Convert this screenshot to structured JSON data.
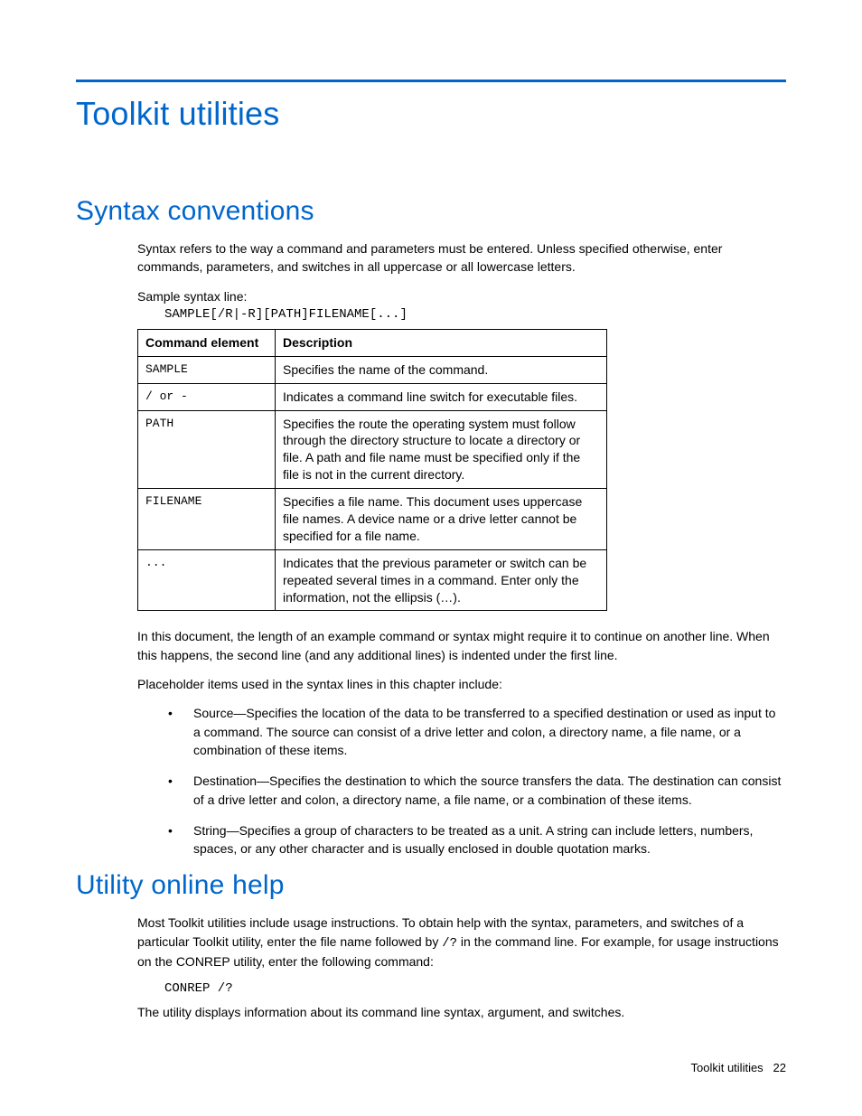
{
  "page": {
    "title": "Toolkit utilities",
    "footer_label": "Toolkit utilities",
    "footer_page": "22"
  },
  "section1": {
    "heading": "Syntax conventions",
    "intro": "Syntax refers to the way a command and parameters must be entered. Unless specified otherwise, enter commands, parameters, and switches in all uppercase or all lowercase letters.",
    "sample_label": "Sample syntax line:",
    "sample_code": "SAMPLE[/R|-R][PATH]FILENAME[...]",
    "table": {
      "headers": {
        "col1": "Command element",
        "col2": "Description"
      },
      "rows": [
        {
          "element": "SAMPLE",
          "desc": "Specifies the name of the command."
        },
        {
          "element": "/ or -",
          "desc": "Indicates a command line switch for executable files."
        },
        {
          "element": "PATH",
          "desc": "Specifies the route the operating system must follow through the directory structure to locate a directory or file. A path and file name must be specified only if the file is not in the current directory."
        },
        {
          "element": "FILENAME",
          "desc": "Specifies a file name. This document uses uppercase file names. A device name or a drive letter cannot be specified for a file name."
        },
        {
          "element": "...",
          "desc": "Indicates that the previous parameter or switch can be repeated several times in a command. Enter only the information, not the ellipsis (…)."
        }
      ]
    },
    "wrap_note": "In this document, the length of an example command or syntax might require it to continue on another line. When this happens, the second line (and any additional lines) is indented under the first line.",
    "placeholder_intro": "Placeholder items used in the syntax lines in this chapter include:",
    "bullets": [
      "Source—Specifies the location of the data to be transferred to a specified destination or used as input to a command. The source can consist of a drive letter and colon, a directory name, a file name, or a combination of these items.",
      "Destination—Specifies the destination to which the source transfers the data. The destination can consist of a drive letter and colon, a directory name, a file name, or a combination of these items.",
      "String—Specifies a group of characters to be treated as a unit. A string can include letters, numbers, spaces, or any other character and is usually enclosed in double quotation marks."
    ]
  },
  "section2": {
    "heading": "Utility online help",
    "para_before": "Most Toolkit utilities include usage instructions. To obtain help with the syntax, parameters, and switches of a particular Toolkit utility, enter the file name followed by ",
    "inline_code": "/?",
    "para_after": " in the command line. For example, for usage instructions on the CONREP utility, enter the following command:",
    "code": "CONREP /?",
    "outro": "The utility displays information about its command line syntax, argument, and switches."
  }
}
